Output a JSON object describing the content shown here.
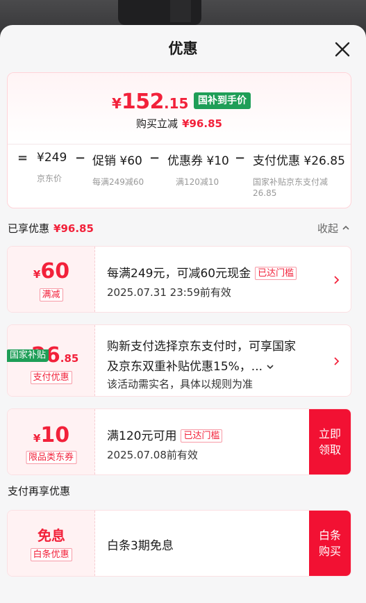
{
  "sheet": {
    "title": "优惠"
  },
  "summary": {
    "currency": "¥",
    "price_int": "152",
    "price_dec": ".15",
    "gov_tag": "国补到手价",
    "saved_label": "购买立减",
    "saved_amount": "¥96.85",
    "formula": {
      "eq": "=",
      "minus": "−",
      "terms": [
        {
          "value": "¥249",
          "caption": "京东价"
        },
        {
          "value": "促销 ¥60",
          "caption": "每满249减60"
        },
        {
          "value": "优惠券 ¥10",
          "caption": "满120减10"
        },
        {
          "value": "支付优惠 ¥26.85",
          "caption": "国家补贴京东支付减26.85"
        }
      ]
    }
  },
  "enjoyed": {
    "label": "已享优惠",
    "amount": "¥96.85",
    "collapse_label": "收起"
  },
  "cards": [
    {
      "sym": "¥",
      "big": "60",
      "small": "",
      "badge": "满减",
      "title": "每满249元，可减60元现金",
      "reached": "已达门槛",
      "sub": "2025.07.31 23:59前有效"
    },
    {
      "corner": "国家补贴",
      "sym": "¥",
      "big": "26",
      "small": ".85",
      "badge": "支付优惠",
      "title": "购新支付选择京东支付时，可享国家",
      "title2": "及京东双重补贴优惠15%，...",
      "sub": "该活动需实名，具体以规则为准"
    },
    {
      "sym": "¥",
      "big": "10",
      "small": "",
      "badge": "限品类东券",
      "title": "满120元可用",
      "reached": "已达门槛",
      "sub": "2025.07.08前有效",
      "cta": "立即领取"
    }
  ],
  "pay_more": {
    "label": "支付再享优惠"
  },
  "baitiao": {
    "big": "免息",
    "badge": "白条优惠",
    "title": "白条3期免息",
    "cta": "白条购买"
  },
  "colors": {
    "accent": "#f2213a",
    "gov_green": "#1e9e57",
    "cta_red": "#f21133"
  }
}
